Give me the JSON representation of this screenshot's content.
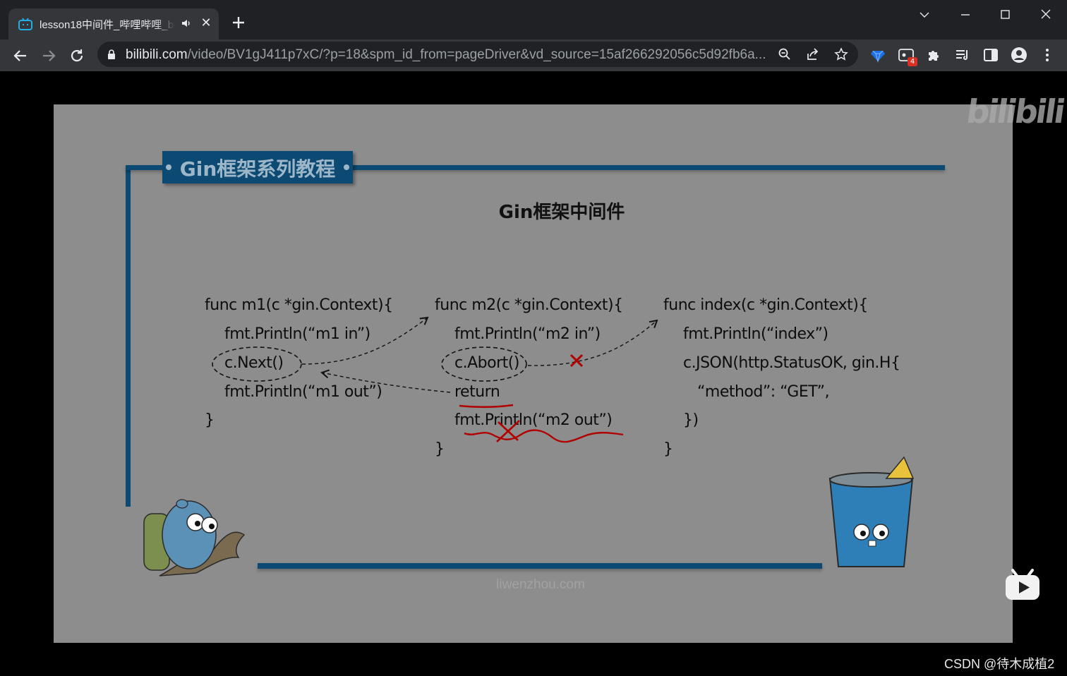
{
  "browser": {
    "tab": {
      "title": "lesson18中间件_哔哩哔哩_bilibili"
    },
    "address": {
      "host": "bilibili.com",
      "path": "/video/BV1gJ411p7xC/?p=18&spm_id_from=pageDriver&vd_source=15af266292056c5d92fb6a..."
    },
    "extensions": {
      "badge_count": "4"
    },
    "colors": {
      "frame": "#202124",
      "toolbar": "#35363a",
      "omnibox": "#202124"
    }
  },
  "slide": {
    "banner": "Gin框架系列教程",
    "title": "Gin框架中间件",
    "code": {
      "m1": [
        "func m1(c *gin.Context){",
        "fmt.Println(“m1 in”)",
        "c.Next()",
        "fmt.Println(“m1 out”)",
        "}"
      ],
      "m2": [
        "func m2(c *gin.Context){",
        "fmt.Println(“m2 in”)",
        "c.Abort()",
        "return",
        "fmt.Println(“m2 out”)",
        "}"
      ],
      "index": [
        "func index(c *gin.Context){",
        "fmt.Println(“index”)",
        "c.JSON(http.StatusOK, gin.H{",
        "“method”: “GET”,",
        "})",
        "}"
      ]
    },
    "site": "liwenzhou.com",
    "colors": {
      "accent": "#0c4a74",
      "background": "#8d8d8d",
      "mark": "#b00000"
    }
  },
  "player": {
    "logo": "bilibili"
  },
  "watermark": "CSDN @待木成植2"
}
